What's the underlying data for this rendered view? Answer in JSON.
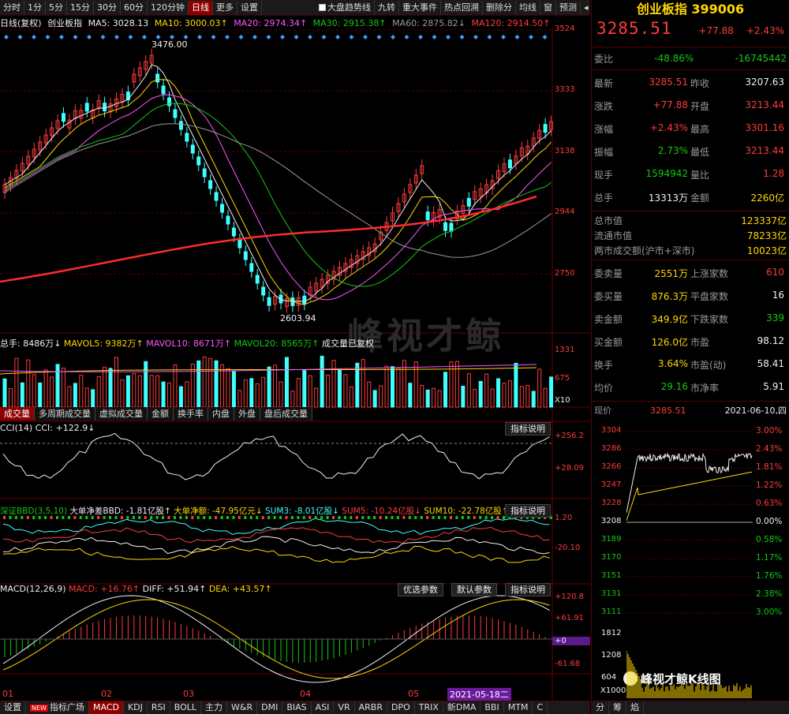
{
  "toolbar": {
    "periods": [
      "分时",
      "1分",
      "5分",
      "15分",
      "30分",
      "60分",
      "120分钟",
      "日线",
      "更多",
      "设置"
    ],
    "active_period": "日线",
    "checkbox_label": "大盘趋势线",
    "tools": [
      "九转",
      "重大事件",
      "热点回溯",
      "删除分",
      "均线",
      "窗",
      "预测"
    ]
  },
  "ma_legend": {
    "period": "日线(复权)",
    "name": "创业板指",
    "ma5": "MA5: 3028.13",
    "ma10": "MA10: 3000.03↑",
    "ma20": "MA20: 2974.34↑",
    "ma30": "MA30: 2915.38↑",
    "ma60": "MA60: 2875.82↓",
    "ma120": "MA120: 2914.50↑"
  },
  "price_axis": [
    "3524",
    "3333",
    "3138",
    "2944",
    "2750"
  ],
  "price_annotations": {
    "high": "3476.00",
    "low": "2603.94"
  },
  "watermark": "峰视才鲸",
  "volume": {
    "legend_total": "总手: 8486万↓",
    "mavol5": "MAVOL5: 9382万↑",
    "mavol10": "MAVOL10: 8671万↑",
    "mavol20": "MAVOL20: 8565万↑",
    "note": "成交量已复权",
    "axis": [
      "1331",
      "675",
      "X10"
    ]
  },
  "volume_tabs": [
    "成交量",
    "多周期成交量",
    "虚拟成交量",
    "金额",
    "换手率",
    "内盘",
    "外盘",
    "盘后成交量"
  ],
  "cci": {
    "legend": "CCI(14) CCI: +122.9↓",
    "help": "指标说明",
    "axis": [
      "+256.2",
      "+28.09"
    ]
  },
  "bbd": {
    "legend_name": "深证BBD(3,5,10)",
    "bbd": "大单净差BBD: -1.81亿股↑",
    "net": "大单净额: -47.95亿元↓",
    "sum3": "SUM3: -8.01亿股↓",
    "sum5": "SUM5: -10.24亿股↓",
    "sum10": "SUM10: -22.78亿股↑",
    "help": "指标说明",
    "axis": [
      "1.20",
      "-20.10"
    ]
  },
  "macd": {
    "legend": "MACD(12,26,9)",
    "macd": "MACD: +16.76↑",
    "diff": "DIFF: +51.94↑",
    "dea": "DEA: +43.57↑",
    "btn_opt": "优选参数",
    "btn_def": "默认参数",
    "help": "指标说明",
    "axis": [
      "+120.8",
      "+61.91",
      "+0",
      "-61.68"
    ]
  },
  "months": [
    "01",
    "02",
    "03",
    "04",
    "05"
  ],
  "cursor_date": "2021-05-18二",
  "bottom_tabs": [
    "设置",
    "指标广场",
    "MACD",
    "KDJ",
    "RSI",
    "BOLL",
    "主力",
    "W&R",
    "DMI",
    "BIAS",
    "ASI",
    "VR",
    "ARBR",
    "DPO",
    "TRIX",
    "新DMA",
    "BBI",
    "MTM",
    "C"
  ],
  "bottom_active": "MACD",
  "new_badge": "NEW",
  "quote": {
    "title": "创业板指 399006",
    "price": "3285.51",
    "change": "+77.88",
    "change_pct": "+2.43%",
    "weibi_label": "委比",
    "weibi_pct": "-48.86%",
    "weibi_val": "-16745442",
    "rows": [
      [
        "最新",
        "3285.51",
        "昨收",
        "3207.63"
      ],
      [
        "涨跌",
        "+77.88",
        "开盘",
        "3213.44"
      ],
      [
        "涨幅",
        "+2.43%",
        "最高",
        "3301.16"
      ],
      [
        "振幅",
        "2.73%",
        "最低",
        "3213.44"
      ],
      [
        "现手",
        "1594942",
        "量比",
        "1.28"
      ],
      [
        "总手",
        "13313万",
        "金额",
        "2260亿"
      ]
    ],
    "mkt_rows": [
      [
        "总市值",
        "123337亿"
      ],
      [
        "流通市值",
        "78233亿"
      ],
      [
        "两市成交额(沪市+深市)",
        "10023亿"
      ]
    ],
    "breadth": [
      [
        "委卖量",
        "2551万",
        "上涨家数",
        "610"
      ],
      [
        "委买量",
        "876.3万",
        "平盘家数",
        "16"
      ],
      [
        "卖金额",
        "349.9亿",
        "下跌家数",
        "339"
      ],
      [
        "买金额",
        "126.0亿",
        "市盈",
        "98.12"
      ],
      [
        "换手",
        "3.64%",
        "市盈(动)",
        "58.41"
      ],
      [
        "均价",
        "29.16",
        "市净率",
        "5.91"
      ]
    ],
    "now_label": "现价",
    "now_price": "3285.51",
    "now_date": "2021-06-10,四"
  },
  "intraday": {
    "left_axis": [
      "3304",
      "3286",
      "3266",
      "3247",
      "3228",
      "3208",
      "3189",
      "3170",
      "3151",
      "3131",
      "3111"
    ],
    "right_axis": [
      "3.00%",
      "2.43%",
      "1.81%",
      "1.22%",
      "0.63%",
      "0.00%",
      "0.58%",
      "1.17%",
      "1.76%",
      "2.38%",
      "3.00%"
    ],
    "vol_axis": [
      "1812",
      "1208",
      "604"
    ],
    "vol_mult": "X1000",
    "bottom_tabs": [
      "分",
      "筹",
      "焰"
    ]
  },
  "brand": "峰视才鲸K线图",
  "colors": {
    "up": "#ff3b3b",
    "down": "#40ffff",
    "bg": "#000000",
    "grid": "#5a0000"
  }
}
